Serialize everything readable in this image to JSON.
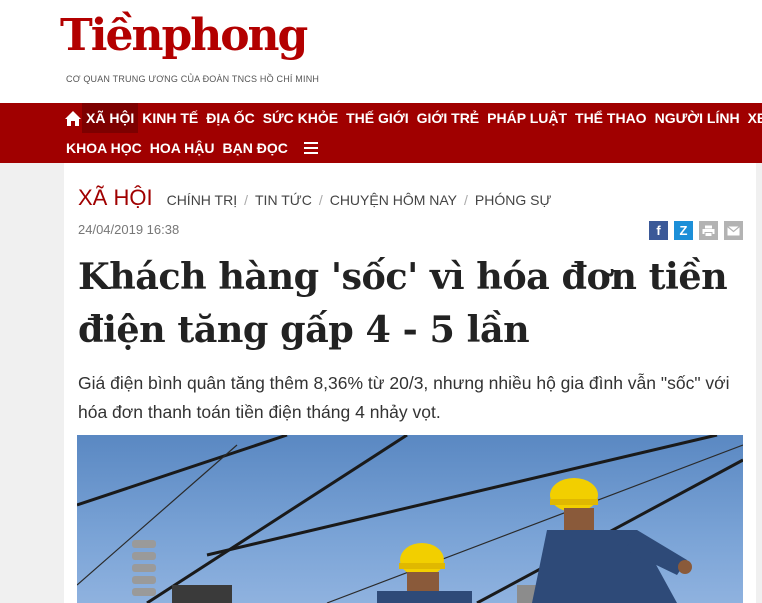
{
  "header": {
    "logo": "Tiềnphong",
    "tagline": "CƠ QUAN TRUNG ƯƠNG CỦA ĐOÀN TNCS HỒ CHÍ MINH"
  },
  "nav": {
    "row1": [
      "XÃ HỘI",
      "KINH TẾ",
      "ĐỊA ỐC",
      "SỨC KHỎE",
      "THẾ GIỚI",
      "GIỚI TRẺ",
      "PHÁP LUẬT",
      "THỂ THAO",
      "NGƯỜI LÍNH",
      "XE"
    ],
    "row2": [
      "KHOA HỌC",
      "HOA HẬU",
      "BẠN ĐỌC"
    ],
    "active": "XÃ HỘI"
  },
  "breadcrumb": {
    "category": "XÃ HỘI",
    "subs": [
      "CHÍNH TRỊ",
      "TIN TỨC",
      "CHUYỆN HÔM NAY",
      "PHÓNG SỰ"
    ],
    "separator": "/"
  },
  "article": {
    "date": "24/04/2019 16:38",
    "title": "Khách hàng 'sốc' vì hóa đơn tiền điện tăng gấp 4 - 5 lần",
    "sapo": "Giá điện bình quân tăng thêm 8,36% từ 20/3, nhưng nhiều hộ gia đình vẫn \"sốc\" với hóa đơn thanh toán tiền điện tháng 4 nhảy vọt."
  },
  "share": {
    "facebook_glyph": "f",
    "zalo_glyph": "Z"
  },
  "colors": {
    "brand_red": "#a00000",
    "facebook": "#3b5998",
    "zalo": "#1c8fd8",
    "icon_grey": "#b3b3b3"
  }
}
